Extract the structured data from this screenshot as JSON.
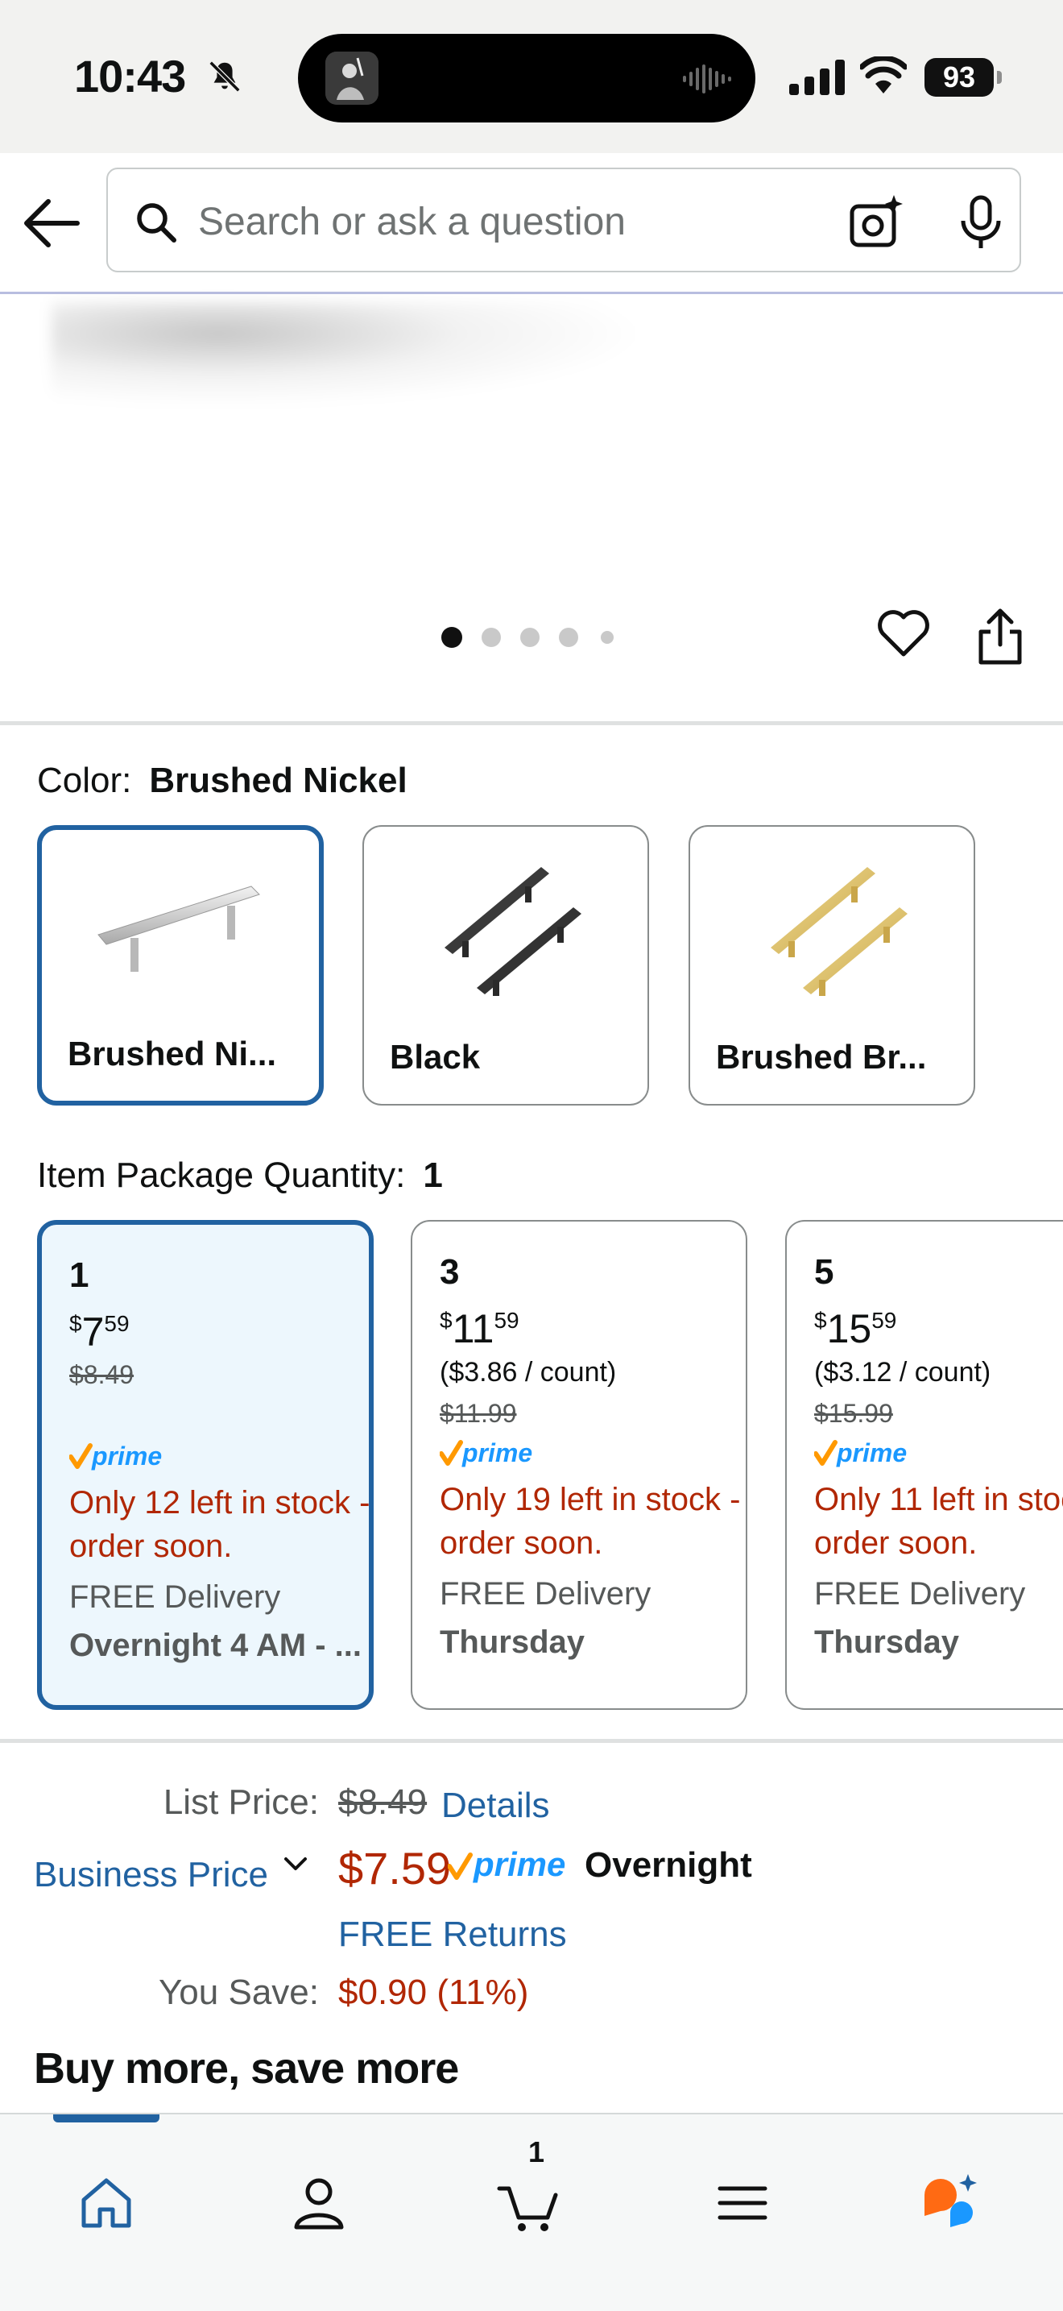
{
  "status_bar": {
    "time": "10:43",
    "battery": "93"
  },
  "search": {
    "placeholder": "Search or ask a question"
  },
  "carousel": {
    "dot_count": 5,
    "active_index": 0
  },
  "color": {
    "label": "Color:",
    "selected_value": "Brushed Nickel",
    "options": [
      {
        "label": "Brushed Ni...",
        "selected": true
      },
      {
        "label": "Black",
        "selected": false
      },
      {
        "label": "Brushed Br...",
        "selected": false
      }
    ]
  },
  "quantity": {
    "label": "Item Package Quantity:",
    "selected_value": "1",
    "options": [
      {
        "count": "1",
        "price_dollars": "7",
        "price_cents": "59",
        "per_count": "",
        "was_price": "$8.49",
        "stock": "Only 12 left in stock - order soon.",
        "delivery_label": "FREE Delivery",
        "delivery_day": "Overnight 4 AM - ...",
        "selected": true
      },
      {
        "count": "3",
        "price_dollars": "11",
        "price_cents": "59",
        "per_count": "($3.86 / count)",
        "was_price": "$11.99",
        "stock": "Only 19 left in stock - order soon.",
        "delivery_label": "FREE Delivery",
        "delivery_day": "Thursday",
        "selected": false
      },
      {
        "count": "5",
        "price_dollars": "15",
        "price_cents": "59",
        "per_count": "($3.12 / count)",
        "was_price": "$15.99",
        "stock": "Only 11 left in stock - order soon.",
        "delivery_label": "FREE Delivery",
        "delivery_day": "Thursday",
        "selected": false
      }
    ]
  },
  "pricing": {
    "list_price_label": "List Price:",
    "list_price": "$8.49",
    "details_link": "Details",
    "business_price_label": "Business Price",
    "price": "$7.59",
    "prime_word": "prime",
    "prime_speed": "Overnight",
    "free_returns": "FREE Returns",
    "you_save_label": "You Save:",
    "you_save": "$0.90 (11%)"
  },
  "section_heading": "Buy more, save more",
  "bottom_nav": {
    "cart_count": "1",
    "active": "home"
  },
  "colors": {
    "accent_blue": "#2162a1",
    "deal_red": "#b12704",
    "prime_blue": "#1a98ff",
    "prime_orange": "#ff9900"
  }
}
